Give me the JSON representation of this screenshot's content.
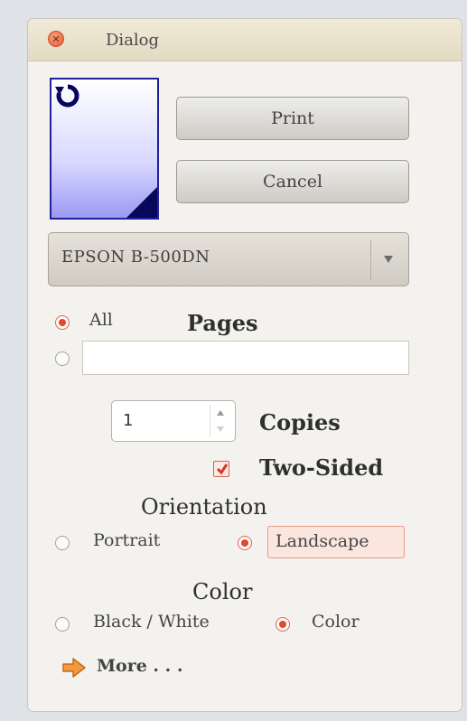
{
  "window": {
    "title": "Dialog"
  },
  "icons": {
    "close": "close-icon",
    "rotate": "rotate-icon",
    "page_corner": "page-corner-icon",
    "dropdown": "chevron-down-icon",
    "more": "arrow-right-icon"
  },
  "buttons": {
    "print": "Print",
    "cancel": "Cancel"
  },
  "printer": {
    "selected": "EPSON B-500DN"
  },
  "pages": {
    "heading": "Pages",
    "all_label": "All",
    "all_selected": true,
    "range_value": ""
  },
  "copies": {
    "heading": "Copies",
    "value": "1"
  },
  "two_sided": {
    "label": "Two-Sided",
    "checked": true
  },
  "orientation": {
    "heading": "Orientation",
    "portrait": "Portrait",
    "landscape": "Landscape",
    "selected": "Landscape"
  },
  "color": {
    "heading": "Color",
    "bw": "Black / White",
    "color": "Color",
    "selected": "Color"
  },
  "more": {
    "label": "More . . ."
  },
  "colors": {
    "accent": "#e34a2a",
    "preview_border": "#22209a",
    "titlebar": "#e8e0cc"
  }
}
